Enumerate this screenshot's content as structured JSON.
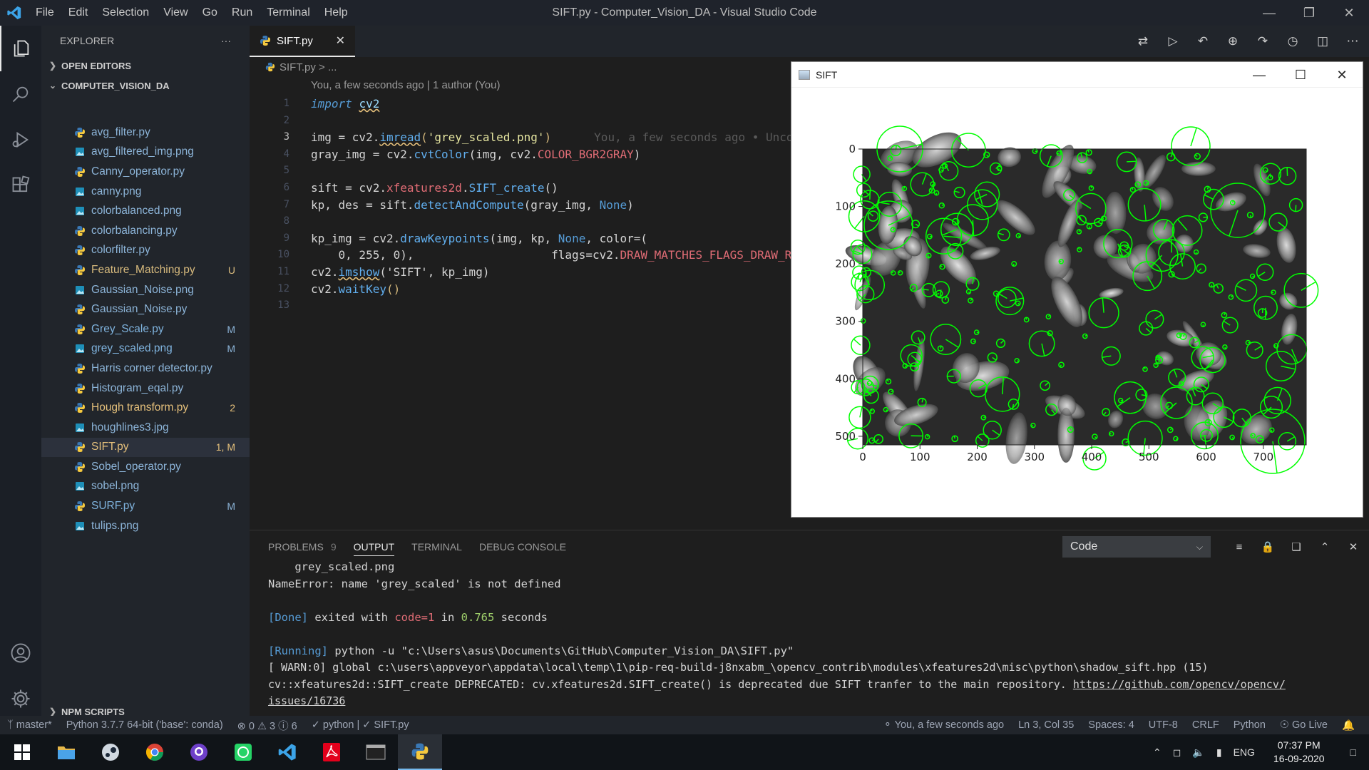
{
  "window": {
    "title": "SIFT.py - Computer_Vision_DA - Visual Studio Code",
    "menu": [
      "File",
      "Edit",
      "Selection",
      "View",
      "Go",
      "Run",
      "Terminal",
      "Help"
    ]
  },
  "sidebar": {
    "header": "EXPLORER",
    "more": "···",
    "open_editors": "OPEN EDITORS",
    "folder": "COMPUTER_VISION_DA",
    "npm_scripts": "NPM SCRIPTS",
    "files": [
      {
        "name": "avg_filter.py",
        "type": "py",
        "badge": "",
        "state": ""
      },
      {
        "name": "avg_filtered_img.png",
        "type": "png",
        "badge": "",
        "state": ""
      },
      {
        "name": "Canny_operator.py",
        "type": "py",
        "badge": "",
        "state": ""
      },
      {
        "name": "canny.png",
        "type": "png",
        "badge": "",
        "state": ""
      },
      {
        "name": "colorbalanced.png",
        "type": "png",
        "badge": "",
        "state": ""
      },
      {
        "name": "colorbalancing.py",
        "type": "py",
        "badge": "",
        "state": ""
      },
      {
        "name": "colorfilter.py",
        "type": "py",
        "badge": "",
        "state": ""
      },
      {
        "name": "Feature_Matching.py",
        "type": "py",
        "badge": "U",
        "state": "untracked"
      },
      {
        "name": "Gaussian_Noise.png",
        "type": "png",
        "badge": "",
        "state": ""
      },
      {
        "name": "Gaussian_Noise.py",
        "type": "py",
        "badge": "",
        "state": ""
      },
      {
        "name": "Grey_Scale.py",
        "type": "py",
        "badge": "M",
        "state": "mod"
      },
      {
        "name": "grey_scaled.png",
        "type": "png",
        "badge": "M",
        "state": "mod"
      },
      {
        "name": "Harris corner detector.py",
        "type": "py",
        "badge": "",
        "state": ""
      },
      {
        "name": "Histogram_eqal.py",
        "type": "py",
        "badge": "",
        "state": ""
      },
      {
        "name": "Hough transform.py",
        "type": "py",
        "badge": "2",
        "state": "err"
      },
      {
        "name": "houghlines3.jpg",
        "type": "png",
        "badge": "",
        "state": ""
      },
      {
        "name": "SIFT.py",
        "type": "py",
        "badge": "1, M",
        "state": "sel"
      },
      {
        "name": "Sobel_operator.py",
        "type": "py",
        "badge": "",
        "state": ""
      },
      {
        "name": "sobel.png",
        "type": "png",
        "badge": "",
        "state": ""
      },
      {
        "name": "SURF.py",
        "type": "py",
        "badge": "M",
        "state": "mod"
      },
      {
        "name": "tulips.png",
        "type": "png",
        "badge": "",
        "state": ""
      }
    ]
  },
  "editor": {
    "tab": "SIFT.py",
    "tab_close": "✕",
    "breadcrumb": "SIFT.py > ...",
    "blame": "You, a few seconds ago | 1 author (You)",
    "line_numbers": [
      "1",
      "2",
      "3",
      "4",
      "5",
      "6",
      "7",
      "8",
      "9",
      "10",
      "11",
      "12",
      "13"
    ],
    "code": {
      "l1_kw": "import",
      "l1_mod": "cv2",
      "l3_a": "img = cv2.",
      "l3_fn": "imread",
      "l3_p1": "(",
      "l3_str": "'grey_scaled.png'",
      "l3_p2": ")",
      "l3_ghost": "You, a few seconds ago • Uncommitted changes",
      "l4_a": "gray_img = cv2.",
      "l4_fn": "cvtColor",
      "l4_b": "(img, cv2.",
      "l4_const": "COLOR_BGR2GRAY",
      "l4_c": ")",
      "l6_a": "sift = cv2.",
      "l6_const": "xfeatures2d",
      "l6_b": ".",
      "l6_fn": "SIFT_create",
      "l6_c": "()",
      "l7_a": "kp, des = sift.",
      "l7_fn": "detectAndCompute",
      "l7_b": "(gray_img, ",
      "l7_none": "None",
      "l7_c": ")",
      "l9_a": "kp_img = cv2.",
      "l9_fn": "drawKeypoints",
      "l9_b": "(img, kp, ",
      "l9_none": "None",
      "l9_c": ", color=(",
      "l10_a": "    0, 255, 0),",
      "l10_b": "                    flags=cv2.",
      "l10_const": "DRAW_MATCHES_FLAGS_DRAW_RICH_KEYPOINTS",
      "l11_a": "cv2.",
      "l11_fn": "imshow",
      "l11_b": "('SIFT', kp_img)",
      "l12_a": "cv2.",
      "l12_fn": "waitKey",
      "l12_b": "()"
    }
  },
  "sift_window": {
    "title": "SIFT",
    "x_ticks": [
      "0",
      "100",
      "200",
      "300",
      "400",
      "500",
      "600",
      "700"
    ],
    "y_ticks": [
      "0",
      "100",
      "200",
      "300",
      "400",
      "500"
    ],
    "keypoint_color": "#00ff00"
  },
  "panel": {
    "tabs": [
      "PROBLEMS",
      "OUTPUT",
      "TERMINAL",
      "DEBUG CONSOLE"
    ],
    "problems_count": "9",
    "output_channel": "Code",
    "output": {
      "l1": "    grey_scaled.png",
      "l2": "NameError: name 'grey_scaled' is not defined",
      "l4_done": "[Done]",
      "l4_a": " exited with ",
      "l4_code": "code=1",
      "l4_b": " in ",
      "l4_time": "0.765",
      "l4_c": " seconds",
      "l6_running": "[Running]",
      "l6_a": " python -u ",
      "l6_path": "\"c:\\Users\\asus\\Documents\\GitHub\\Computer_Vision_DA\\SIFT.py\"",
      "l7": "[ WARN:0] global c:\\users\\appveyor\\appdata\\local\\temp\\1\\pip-req-build-j8nxabm_\\opencv_contrib\\modules\\xfeatures2d\\misc\\python\\shadow_sift.hpp (15)",
      "l8_a": "cv::xfeatures2d::SIFT_create DEPRECATED: cv.xfeatures2d.SIFT_create() is deprecated due SIFT tranfer to the main repository. ",
      "l8_link": "https://github.com/opencv/opencv/",
      "l9_link": "issues/16736"
    }
  },
  "statusbar": {
    "branch": "master*",
    "interpreter": "Python 3.7.7 64-bit ('base': conda)",
    "errors": "0",
    "warnings": "3",
    "infos": "6",
    "check": "✓ python | ✓ SIFT.py",
    "blame": "You, a few seconds ago",
    "position": "Ln 3, Col 35",
    "spaces": "Spaces: 4",
    "encoding": "UTF-8",
    "eol": "CRLF",
    "language": "Python",
    "golive": "Go Live"
  },
  "taskbar": {
    "lang": "ENG",
    "time": "07:37 PM",
    "date": "16-09-2020"
  }
}
